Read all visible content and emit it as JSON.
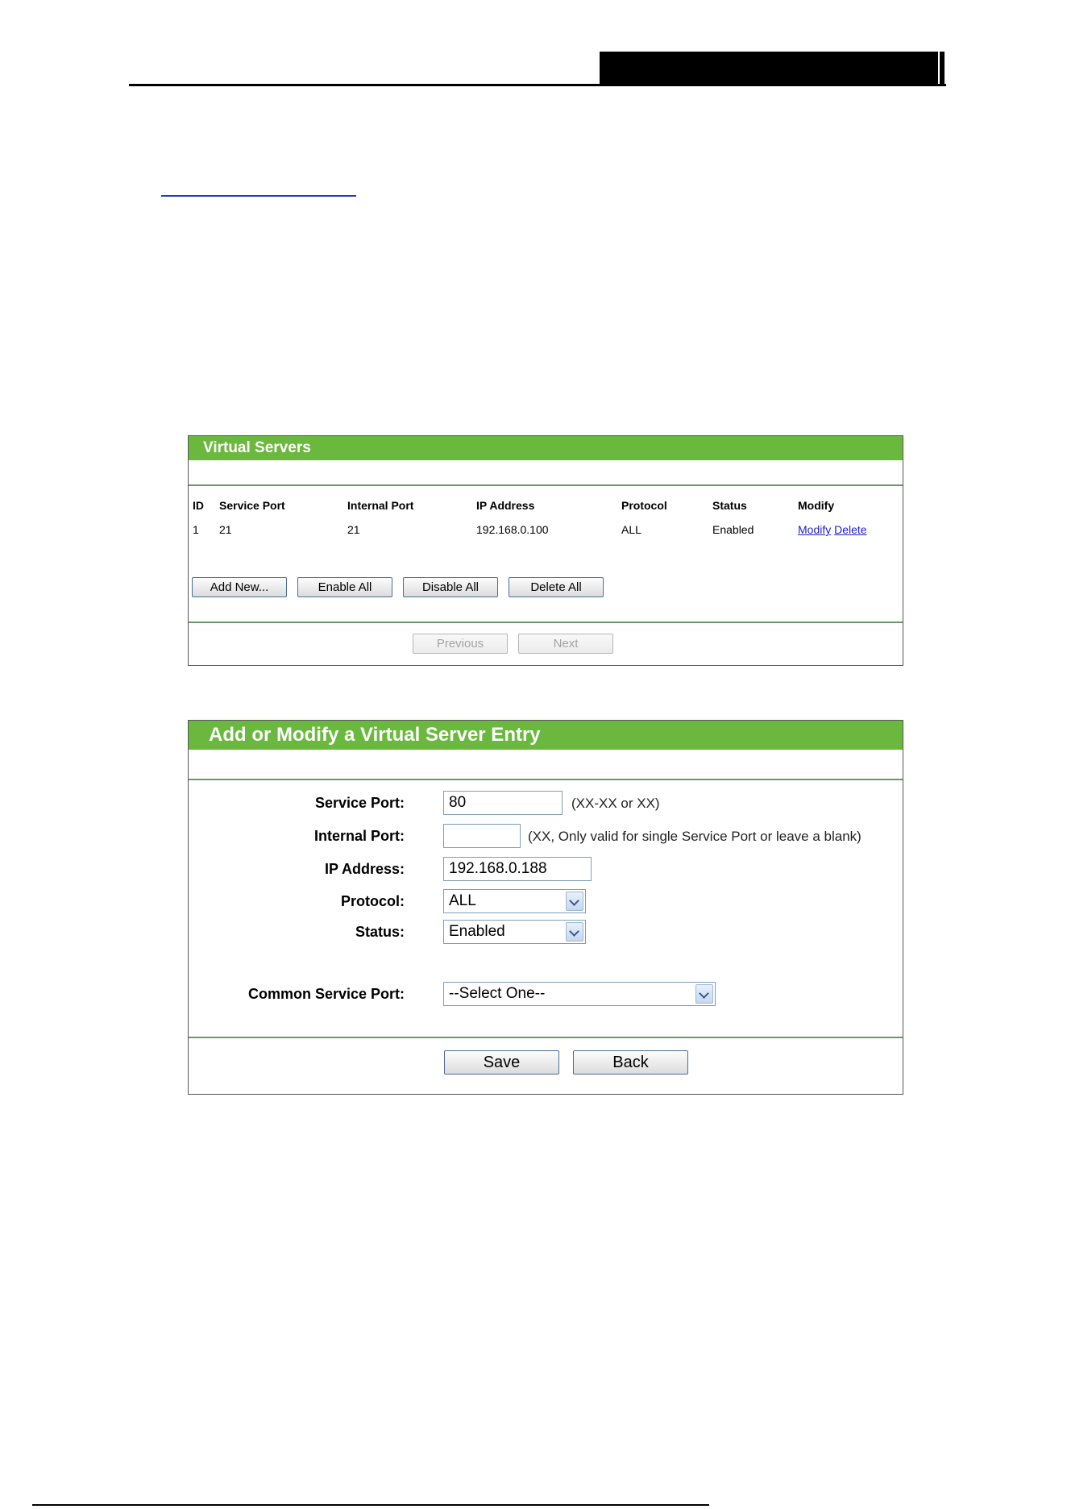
{
  "virtual_servers": {
    "title": "Virtual Servers",
    "columns": [
      "ID",
      "Service Port",
      "Internal Port",
      "IP Address",
      "Protocol",
      "Status",
      "Modify"
    ],
    "rows": [
      {
        "id": "1",
        "service_port": "21",
        "internal_port": "21",
        "ip": "192.168.0.100",
        "protocol": "ALL",
        "status": "Enabled",
        "modify_label": "Modify",
        "delete_label": "Delete"
      }
    ],
    "buttons": {
      "add_new": "Add New...",
      "enable_all": "Enable All",
      "disable_all": "Disable All",
      "delete_all": "Delete All"
    },
    "pager": {
      "previous": "Previous",
      "next": "Next"
    }
  },
  "add_modify": {
    "title": "Add or Modify a Virtual Server Entry",
    "service_port": {
      "label": "Service Port:",
      "value": "80",
      "hint": "(XX-XX or XX)"
    },
    "internal_port": {
      "label": "Internal Port:",
      "value": "",
      "hint": "(XX, Only valid for single Service Port or leave a blank)"
    },
    "ip_address": {
      "label": "IP Address:",
      "value": "192.168.0.188"
    },
    "protocol": {
      "label": "Protocol:",
      "value": "ALL"
    },
    "status": {
      "label": "Status:",
      "value": "Enabled"
    },
    "common_service_port": {
      "label": "Common Service Port:",
      "value": "--Select One--"
    },
    "buttons": {
      "save": "Save",
      "back": "Back"
    }
  },
  "colors": {
    "panel_header": "#6ab83e",
    "link": "#1f1fcf",
    "divider": "#6a9a64"
  }
}
